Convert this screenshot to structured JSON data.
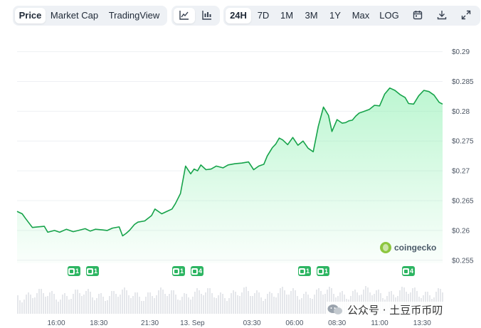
{
  "tabs": {
    "price": "Price",
    "market_cap": "Market Cap",
    "tradingview": "TradingView"
  },
  "chart_icons": [
    "line-chart-icon",
    "candlestick-icon"
  ],
  "ranges": [
    "24H",
    "7D",
    "1M",
    "3M",
    "1Y",
    "Max",
    "LOG"
  ],
  "active_range": "24H",
  "tool_icons": [
    "calendar-icon",
    "download-icon",
    "expand-icon"
  ],
  "logo": {
    "text": "coingecko"
  },
  "badges": [
    {
      "label": "1"
    },
    {
      "label": "1"
    },
    {
      "label": "1"
    },
    {
      "label": "4"
    },
    {
      "label": "1"
    },
    {
      "label": "1"
    },
    {
      "label": "4"
    }
  ],
  "watermark": {
    "text": "公众号 · 土豆币币叨"
  },
  "colors": {
    "line": "#16a34a",
    "fill_top": "#86efac",
    "volume": "#e5e7eb",
    "badge": "#2db562",
    "active_tab_bg": "#ffffff",
    "toolbar_bg": "#eef1f5"
  },
  "chart_data": {
    "type": "area",
    "title": "",
    "xlabel": "",
    "ylabel": "",
    "ylim": [
      0.2545,
      0.2915
    ],
    "yticks": [
      "$0.29",
      "$0.285",
      "$0.28",
      "$0.275",
      "$0.27",
      "$0.265",
      "$0.26",
      "$0.255"
    ],
    "ytick_values": [
      0.29,
      0.285,
      0.28,
      0.275,
      0.27,
      0.265,
      0.26,
      0.255
    ],
    "xticks": [
      "16:00",
      "18:30",
      "21:30",
      "13. Sep",
      "03:30",
      "06:00",
      "08:30",
      "11:00",
      "13:30"
    ],
    "xtick_hours": [
      2.3,
      4.8,
      7.8,
      10.3,
      13.8,
      16.3,
      18.8,
      21.3,
      23.8
    ],
    "x_hours": [
      0,
      0.3,
      0.5,
      0.9,
      1.2,
      1.6,
      1.8,
      2.2,
      2.5,
      2.9,
      3.3,
      3.6,
      4,
      4.3,
      4.6,
      5,
      5.3,
      5.6,
      6,
      6.2,
      6.4,
      6.6,
      6.9,
      7.1,
      7.5,
      7.9,
      8.1,
      8.5,
      8.8,
      9.1,
      9.3,
      9.6,
      9.9,
      10.2,
      10.4,
      10.6,
      10.8,
      11.1,
      11.4,
      11.7,
      12.1,
      12.4,
      12.8,
      13.2,
      13.6,
      13.9,
      14.2,
      14.5,
      14.7,
      15,
      15.2,
      15.4,
      15.6,
      15.9,
      16.2,
      16.5,
      16.8,
      17.1,
      17.4,
      17.7,
      18,
      18.3,
      18.5,
      18.8,
      19.1,
      19.3,
      19.5,
      19.7,
      19.9,
      20.1,
      20.4,
      20.7,
      21,
      21.3,
      21.6,
      21.9,
      22.2,
      22.5,
      22.8,
      23,
      23.3,
      23.6,
      23.9,
      24.2,
      24.5,
      24.8,
      25
    ],
    "y_values": [
      0.2632,
      0.2628,
      0.262,
      0.2605,
      0.2606,
      0.2607,
      0.2597,
      0.26,
      0.2597,
      0.2602,
      0.2598,
      0.26,
      0.2603,
      0.2599,
      0.2602,
      0.2601,
      0.26,
      0.2604,
      0.2606,
      0.2591,
      0.2595,
      0.26,
      0.261,
      0.2614,
      0.2616,
      0.2625,
      0.2636,
      0.2628,
      0.2632,
      0.2636,
      0.2645,
      0.2662,
      0.2708,
      0.2695,
      0.2703,
      0.27,
      0.271,
      0.2702,
      0.2703,
      0.2708,
      0.2705,
      0.271,
      0.2712,
      0.2713,
      0.2715,
      0.2702,
      0.2708,
      0.2711,
      0.2725,
      0.2739,
      0.2745,
      0.2755,
      0.2752,
      0.2744,
      0.2756,
      0.2743,
      0.275,
      0.2738,
      0.2732,
      0.2775,
      0.2807,
      0.2793,
      0.2766,
      0.2786,
      0.278,
      0.2781,
      0.2784,
      0.2785,
      0.2792,
      0.2797,
      0.28,
      0.2803,
      0.281,
      0.2809,
      0.2829,
      0.2839,
      0.2835,
      0.2828,
      0.2823,
      0.2813,
      0.2812,
      0.2826,
      0.2835,
      0.2833,
      0.2827,
      0.2815,
      0.2812
    ],
    "grid": true,
    "legend": "none"
  }
}
